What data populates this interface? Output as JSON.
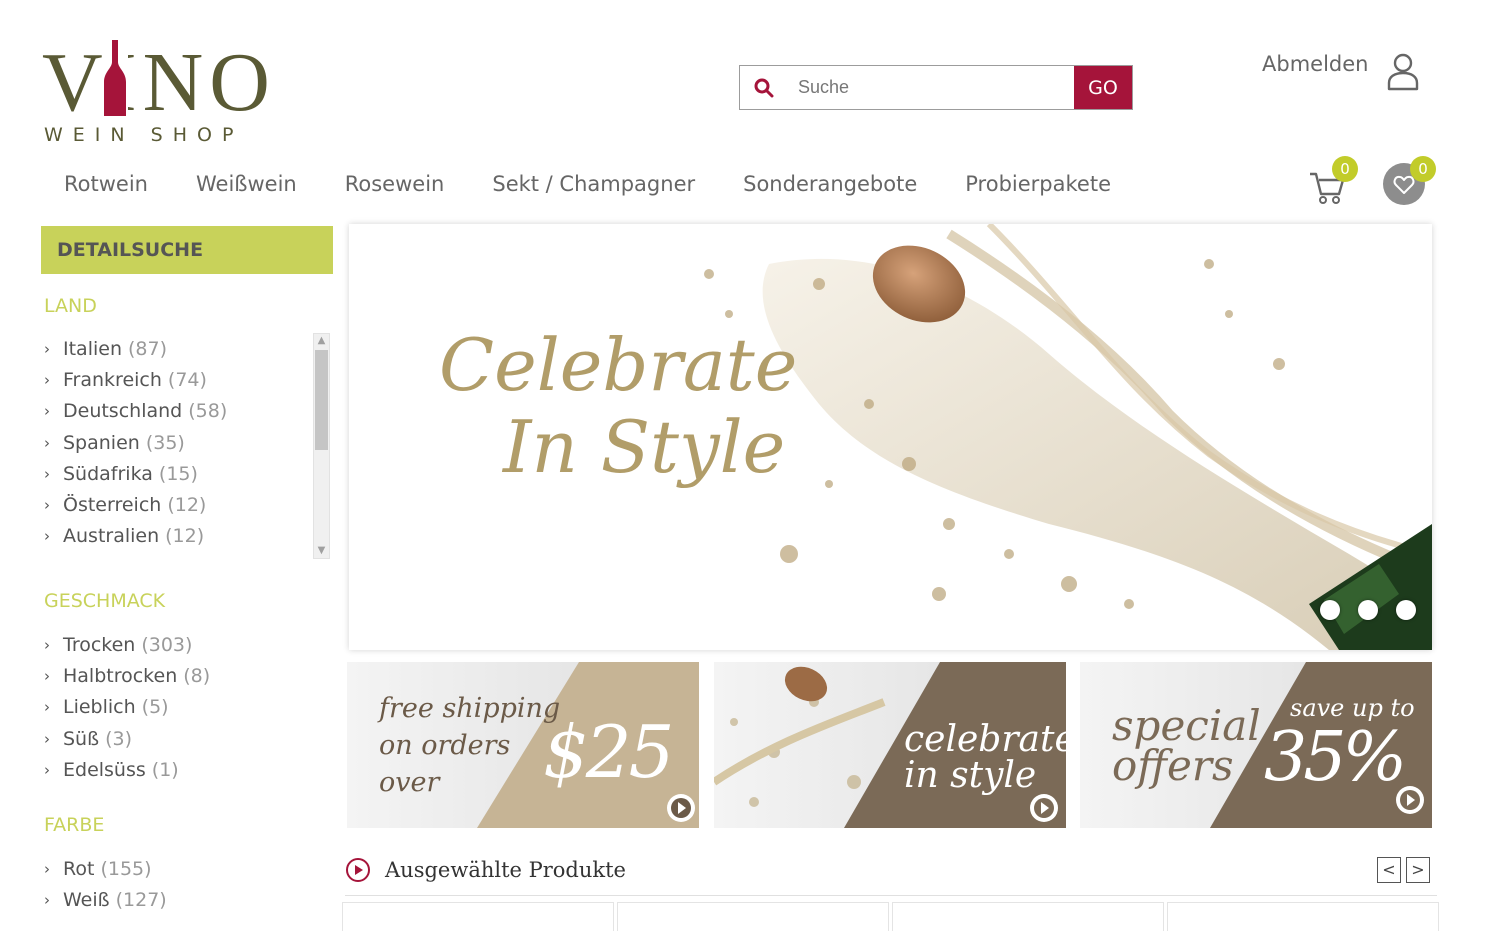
{
  "brand": {
    "name": "VINO",
    "tagline": "WEIN SHOP",
    "primary_color": "#5a5a35",
    "accent_color": "#a5143a",
    "highlight_color": "#c8d25a"
  },
  "search": {
    "placeholder": "Suche",
    "button_label": "GO"
  },
  "account": {
    "logout_label": "Abmelden"
  },
  "nav": {
    "items": [
      "Rotwein",
      "Weißwein",
      "Rosewein",
      "Sekt / Champagner",
      "Sonderangebote",
      "Probierpakete"
    ]
  },
  "cart": {
    "count": "0"
  },
  "wishlist": {
    "count": "0"
  },
  "sidebar": {
    "title": "DETAILSUCHE",
    "land": {
      "title": "LAND",
      "items": [
        {
          "label": "Italien",
          "count": "(87)"
        },
        {
          "label": "Frankreich",
          "count": "(74)"
        },
        {
          "label": "Deutschland",
          "count": "(58)"
        },
        {
          "label": "Spanien",
          "count": "(35)"
        },
        {
          "label": "Südafrika",
          "count": "(15)"
        },
        {
          "label": "Österreich",
          "count": "(12)"
        },
        {
          "label": "Australien",
          "count": "(12)"
        }
      ]
    },
    "geschmack": {
      "title": "GESCHMACK",
      "items": [
        {
          "label": "Trocken",
          "count": "(303)"
        },
        {
          "label": "Halbtrocken",
          "count": "(8)"
        },
        {
          "label": "Lieblich",
          "count": "(5)"
        },
        {
          "label": "Süß",
          "count": "(3)"
        },
        {
          "label": "Edelsüss",
          "count": "(1)"
        }
      ]
    },
    "farbe": {
      "title": "FARBE",
      "items": [
        {
          "label": "Rot",
          "count": "(155)"
        },
        {
          "label": "Weiß",
          "count": "(127)"
        }
      ]
    }
  },
  "hero": {
    "line1": "Celebrate",
    "line2": "In Style",
    "slides": 3
  },
  "promos": [
    {
      "text_lines": [
        "free shipping",
        "on orders",
        "over"
      ],
      "big": "$25"
    },
    {
      "text_lines": [
        "celebrate",
        "in style"
      ]
    },
    {
      "text_lines": [
        "special",
        "offers"
      ],
      "small": "save up to",
      "big": "35%"
    }
  ],
  "featured": {
    "title": "Ausgewählte Produkte",
    "prev": "<",
    "next": ">"
  }
}
